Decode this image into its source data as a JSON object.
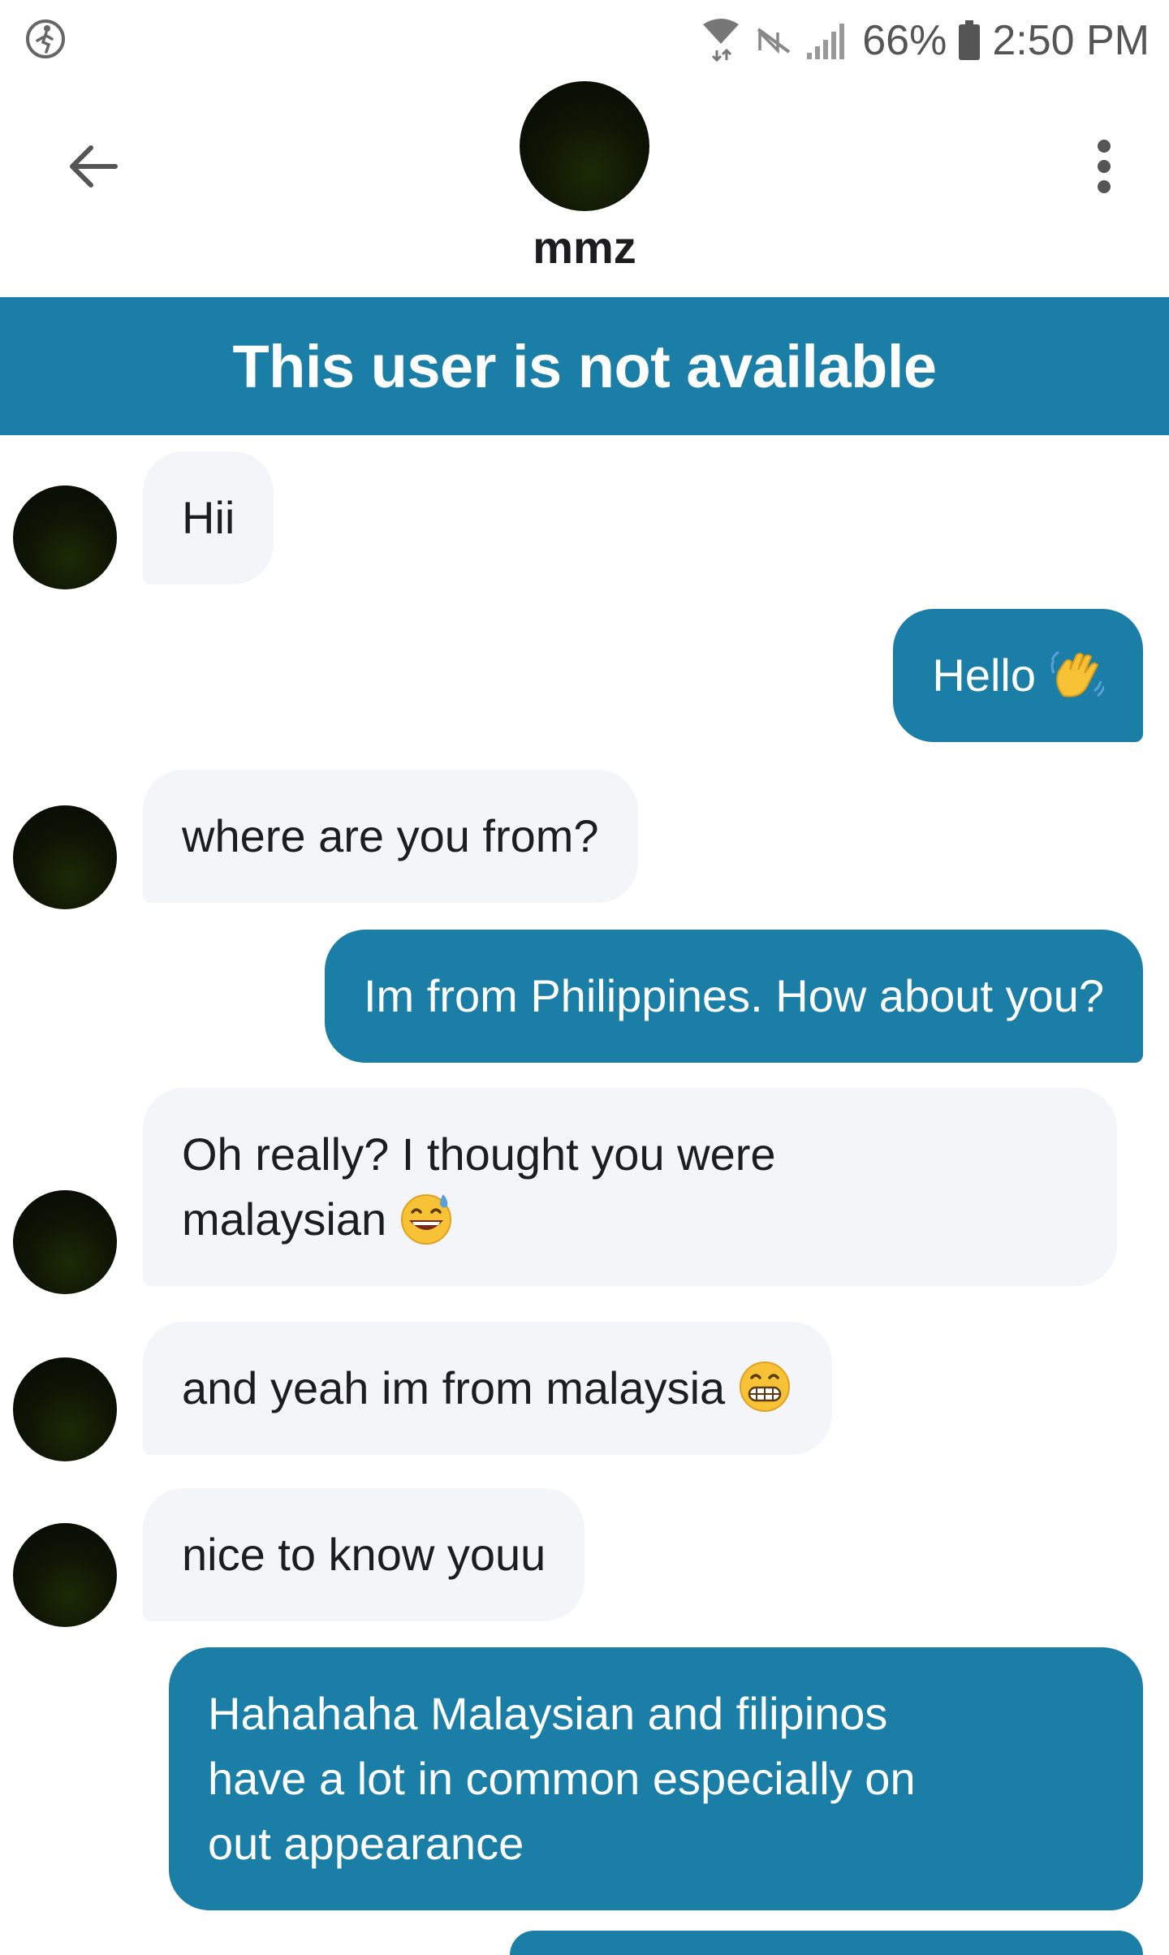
{
  "status_bar": {
    "battery_percent": "66%",
    "time": "2:50 PM"
  },
  "header": {
    "contact_name": "mmz"
  },
  "banner": {
    "text": "This user is not available"
  },
  "messages": [
    {
      "from": "them",
      "text": "Hii"
    },
    {
      "from": "me",
      "text": "Hello",
      "emoji": "waving-hand-icon"
    },
    {
      "from": "them",
      "text": "where are you from?"
    },
    {
      "from": "me",
      "text": "Im from Philippines. How about you?"
    },
    {
      "from": "them",
      "text_line1": "Oh really? I thought you were",
      "text_line2": "malaysian",
      "emoji": "grinning-sweat-face-icon"
    },
    {
      "from": "them",
      "text": "and yeah im from malaysia",
      "emoji": "grimacing-face-icon"
    },
    {
      "from": "them",
      "text": "nice to know youu"
    },
    {
      "from": "me",
      "text_line1": "Hahahaha Malaysian and filipinos",
      "text_line2": "have a lot in common especially on",
      "text_line3": "out appearance"
    }
  ],
  "colors": {
    "accent": "#1a7ea6",
    "incoming_bubble": "#f4f5f9"
  }
}
